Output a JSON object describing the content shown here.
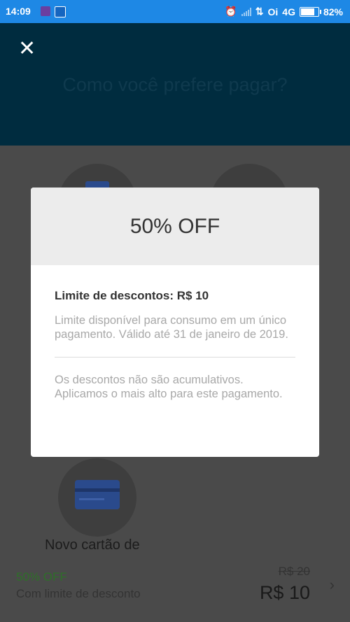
{
  "status_bar": {
    "time": "14:09",
    "carrier": "Oi",
    "network": "4G",
    "battery": "82%",
    "battery_level": 0.82
  },
  "header": {
    "title": "Como você prefere pagar?"
  },
  "background": {
    "new_card_label": "Novo cartão de"
  },
  "modal": {
    "title": "50% OFF",
    "limit_title": "Limite de descontos: R$ 10",
    "limit_description": "Limite disponível para consumo em um único pagamento. Válido até 31 de janeiro de 2019.",
    "notice": "Os descontos não são acumulativos. Aplicamos o mais alto para este pagamento."
  },
  "bottom_bar": {
    "discount": "50% OFF",
    "discount_note": "Com limite de desconto",
    "old_price": "R$ 20",
    "new_price": "R$ 10"
  },
  "colors": {
    "status_bar": "#1e88e5",
    "header": "#002c3f",
    "overlay": "#4a4a4a",
    "discount_green": "#2e6f28"
  }
}
